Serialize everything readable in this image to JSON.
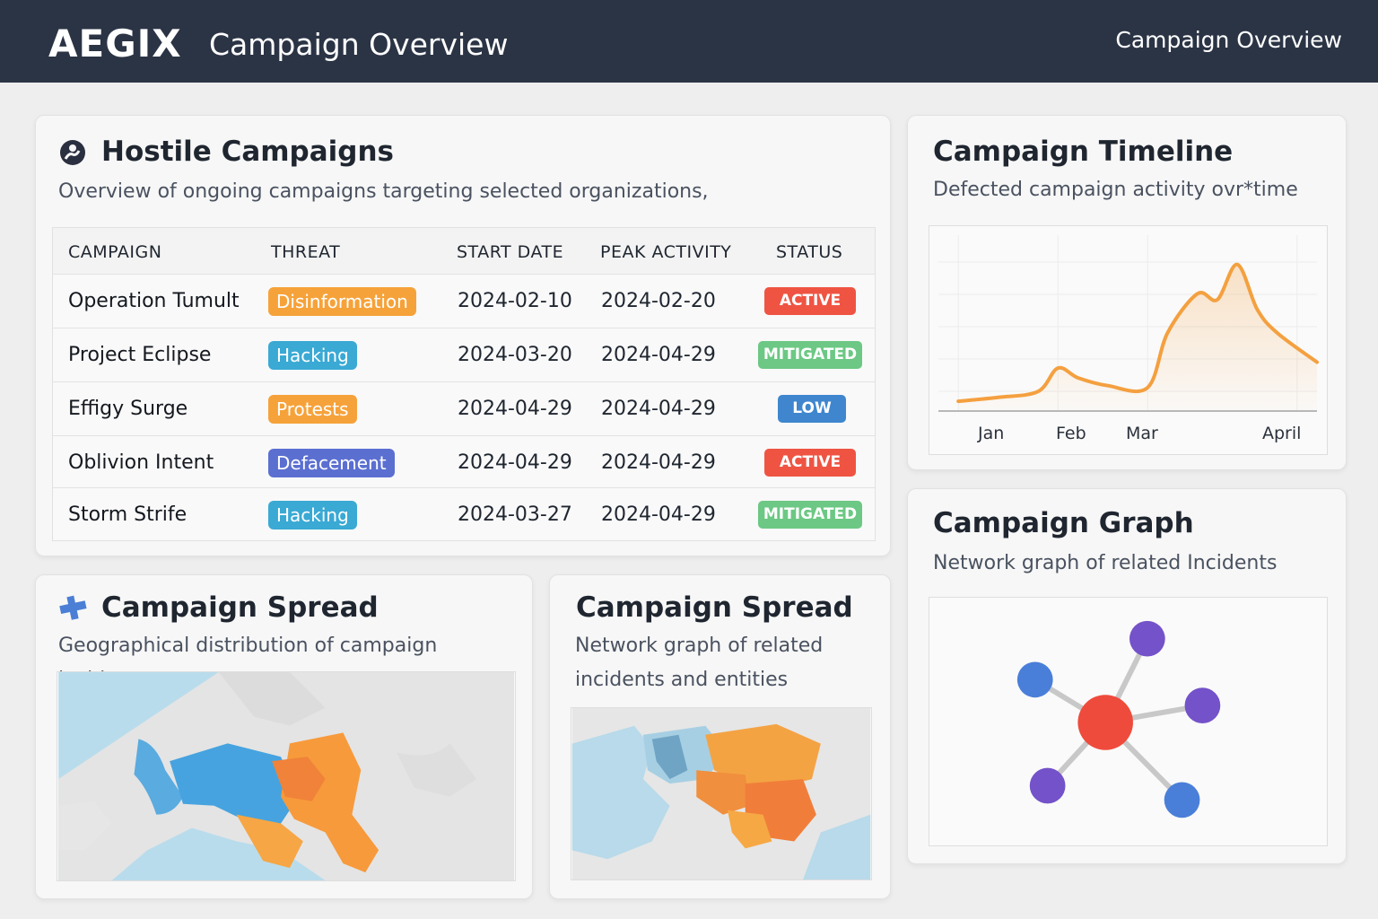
{
  "header": {
    "brand": "AEGIX",
    "title": "Campaign Overview",
    "right_label": "Campaign Overview"
  },
  "colors": {
    "header_bg": "#2b3445",
    "orange": "#f6a23a",
    "cyan": "#3aa9d4",
    "indigo": "#5b6fd1",
    "active": "#ef5443",
    "mitigated": "#6cc884",
    "low": "#3f86cf",
    "graph_center": "#ef4b3c",
    "graph_blue": "#4a7fd9",
    "graph_purple": "#7452c9"
  },
  "campaigns_card": {
    "title": "Hostile Campaigns",
    "subtitle": "Overview of ongoing campaigns targeting selected organizations,",
    "icon": "hostile-globe-icon",
    "columns": [
      "CAMPAIGN",
      "THREAT",
      "START DATE",
      "PEAK ACTIVITY",
      "STATUS"
    ],
    "rows": [
      {
        "campaign": "Operation Tumult",
        "threat": "Disinformation",
        "threat_color": "#f6a23a",
        "start": "2024-02-10",
        "peak": "2024-02-20",
        "status": "ACTIVE",
        "status_color": "#ef5443"
      },
      {
        "campaign": "Project Eclipse",
        "threat": "Hacking",
        "threat_color": "#3aa9d4",
        "start": "2024-03-20",
        "peak": "2024-04-29",
        "status": "MITIGATED",
        "status_color": "#6cc884"
      },
      {
        "campaign": "Effigy Surge",
        "threat": "Protests",
        "threat_color": "#f6a23a",
        "start": "2024-04-29",
        "peak": "2024-04-29",
        "status": "LOW",
        "status_color": "#3f86cf"
      },
      {
        "campaign": "Oblivion Intent",
        "threat": "Defacement",
        "threat_color": "#5b6fd1",
        "start": "2024-04-29",
        "peak": "2024-04-29",
        "status": "ACTIVE",
        "status_color": "#ef5443"
      },
      {
        "campaign": "Storm Strife",
        "threat": "Hacking",
        "threat_color": "#3aa9d4",
        "start": "2024-03-27",
        "peak": "2024-04-29",
        "status": "MITIGATED",
        "status_color": "#6cc884"
      }
    ]
  },
  "spread_map_card": {
    "title": "Campaign Spread",
    "subtitle": "Geographical distribution of campaign incidents",
    "icon": "puzzle-icon"
  },
  "spread_graph_card": {
    "title": "Campaign Spread",
    "subtitle_line1": "Network graph of related",
    "subtitle_line2": "incidents and entities"
  },
  "timeline_card": {
    "title": "Campaign Timeline",
    "subtitle": "Defected campaign activity ovr*time"
  },
  "graph_card": {
    "title": "Campaign Graph",
    "subtitle": "Network graph of related Incidents"
  },
  "chart_data": {
    "type": "area",
    "x_tick_labels": [
      "Jan",
      "Feb",
      "Mar",
      "April"
    ],
    "x": [
      0,
      0.4,
      0.8,
      1.0,
      1.2,
      1.5,
      1.9,
      2.1,
      2.4,
      2.6,
      2.8,
      3.0,
      3.2,
      3.6
    ],
    "values": [
      5,
      7,
      10,
      22,
      17,
      13,
      12,
      40,
      60,
      57,
      75,
      52,
      40,
      25
    ],
    "xlim": [
      -0.2,
      3.6
    ],
    "ylim": [
      0,
      90
    ],
    "grid": true,
    "color": "#f4a040"
  }
}
